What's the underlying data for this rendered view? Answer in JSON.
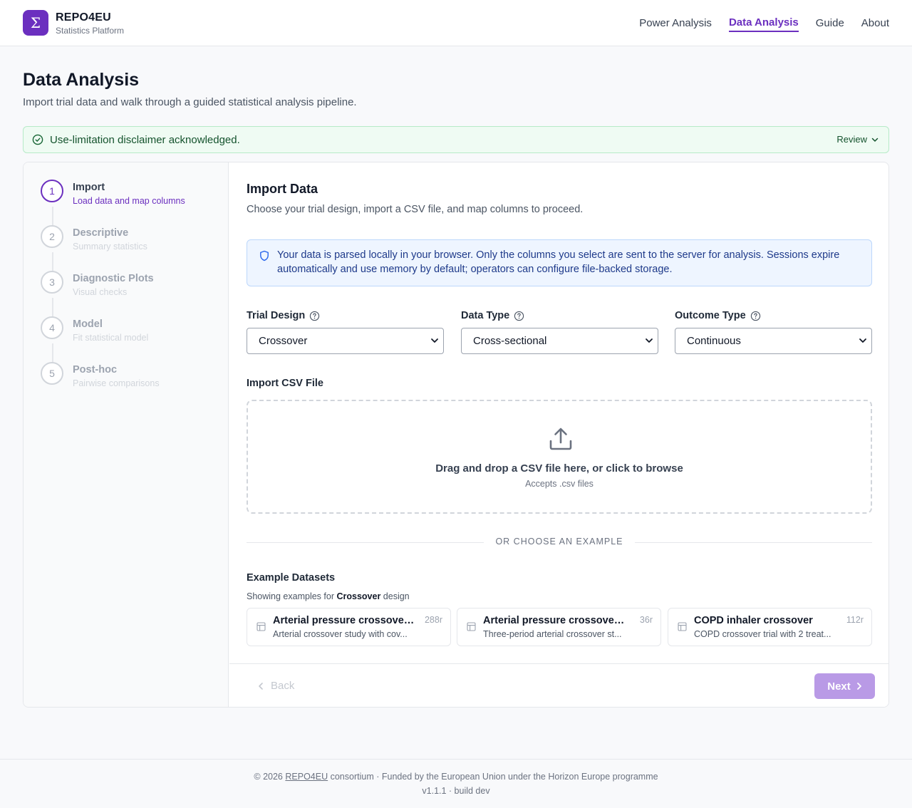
{
  "brand": {
    "name": "REPO4EU",
    "subtitle": "Statistics Platform",
    "logo_glyph": "Σ"
  },
  "nav": {
    "items": [
      {
        "label": "Power Analysis",
        "active": false
      },
      {
        "label": "Data Analysis",
        "active": true
      },
      {
        "label": "Guide",
        "active": false
      },
      {
        "label": "About",
        "active": false
      }
    ]
  },
  "page": {
    "title": "Data Analysis",
    "subtitle": "Import trial data and walk through a guided statistical analysis pipeline."
  },
  "disclaimer": {
    "text": "Use-limitation disclaimer acknowledged.",
    "review_label": "Review"
  },
  "steps": [
    {
      "number": "1",
      "label": "Import",
      "desc": "Load data and map columns",
      "active": true
    },
    {
      "number": "2",
      "label": "Descriptive",
      "desc": "Summary statistics",
      "active": false
    },
    {
      "number": "3",
      "label": "Diagnostic Plots",
      "desc": "Visual checks",
      "active": false
    },
    {
      "number": "4",
      "label": "Model",
      "desc": "Fit statistical model",
      "active": false
    },
    {
      "number": "5",
      "label": "Post-hoc",
      "desc": "Pairwise comparisons",
      "active": false
    }
  ],
  "import_section": {
    "title": "Import Data",
    "subtitle": "Choose your trial design, import a CSV file, and map columns to proceed.",
    "privacy_note": "Your data is parsed locally in your browser. Only the columns you select are sent to the server for analysis. Sessions expire automatically and use memory by default; operators can configure file-backed storage."
  },
  "fields": {
    "trial_design": {
      "label": "Trial Design",
      "value": "Crossover"
    },
    "data_type": {
      "label": "Data Type",
      "value": "Cross-sectional"
    },
    "outcome_type": {
      "label": "Outcome Type",
      "value": "Continuous"
    }
  },
  "upload": {
    "label": "Import CSV File",
    "prompt": "Drag and drop a CSV file here, or click to browse",
    "accepts": "Accepts .csv files"
  },
  "divider_text": "OR CHOOSE AN EXAMPLE",
  "examples": {
    "title": "Example Datasets",
    "sub_prefix": "Showing examples for",
    "sub_design": "Crossover",
    "sub_suffix": "design",
    "items": [
      {
        "name": "Arterial pressure crossover ...",
        "rows": "288r",
        "desc": "Arterial crossover study with cov..."
      },
      {
        "name": "Arterial pressure crossover (...",
        "rows": "36r",
        "desc": "Three-period arterial crossover st..."
      },
      {
        "name": "COPD inhaler crossover",
        "rows": "112r",
        "desc": "COPD crossover trial with 2 treat..."
      }
    ]
  },
  "wizard_nav": {
    "back_label": "Back",
    "next_label": "Next"
  },
  "footer": {
    "copyright_prefix": "© 2026",
    "org_link": "REPO4EU",
    "copyright_suffix": "consortium · Funded by the European Union under the Horizon Europe programme",
    "version": "v1.1.1 · build dev"
  },
  "colors": {
    "accent": "#6b2fbf",
    "success_bg": "#effbf3",
    "info_bg": "#eef5ff",
    "next_disabled": "#b99ae6"
  }
}
